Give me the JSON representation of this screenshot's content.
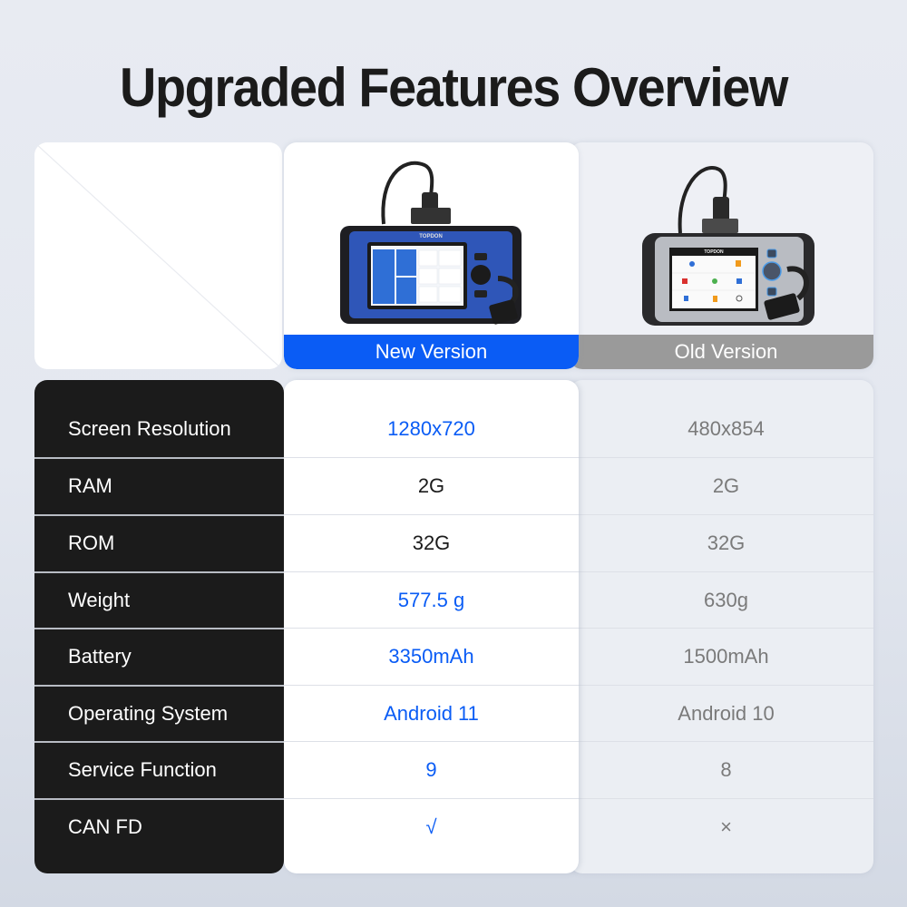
{
  "title": "Upgraded Features Overview",
  "header": {
    "new_version_label": "New Version",
    "old_version_label": "Old Version",
    "new_device_brand": "TOPDON",
    "old_device_brand": "TOPDON"
  },
  "colors": {
    "accent_blue": "#0a5cf5",
    "old_gray": "#9a9a9a",
    "label_column_bg": "#1b1b1b"
  },
  "table": {
    "rows": [
      {
        "feature": "Screen Resolution",
        "new": "1280x720",
        "old": "480x854",
        "new_highlight": true
      },
      {
        "feature": "RAM",
        "new": "2G",
        "old": "2G",
        "new_highlight": false
      },
      {
        "feature": "ROM",
        "new": "32G",
        "old": "32G",
        "new_highlight": false
      },
      {
        "feature": "Weight",
        "new": "577.5 g",
        "old": "630g",
        "new_highlight": true
      },
      {
        "feature": "Battery",
        "new": "3350mAh",
        "old": "1500mAh",
        "new_highlight": true
      },
      {
        "feature": "Operating System",
        "new": "Android 11",
        "old": "Android 10",
        "new_highlight": true
      },
      {
        "feature": "Service Function",
        "new": "9",
        "old": "8",
        "new_highlight": true
      },
      {
        "feature": "CAN FD",
        "new": "√",
        "old": "×",
        "new_highlight": true
      }
    ]
  }
}
